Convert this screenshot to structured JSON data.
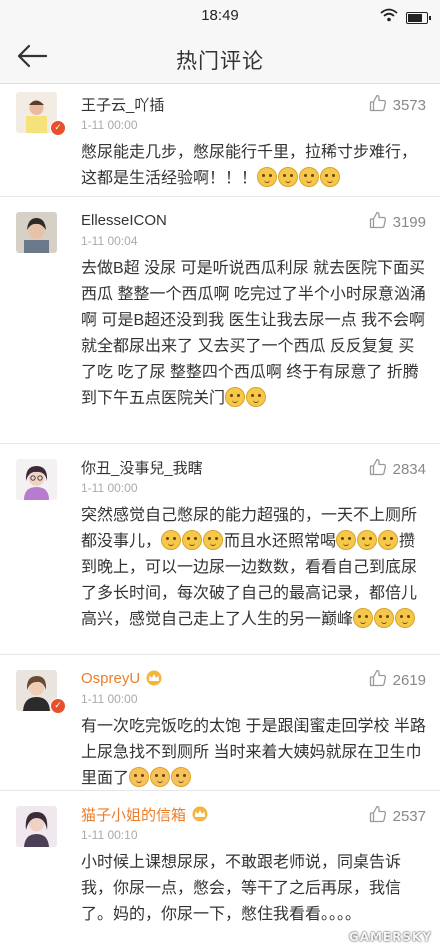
{
  "status_bar": {
    "time": "18:49"
  },
  "nav": {
    "title": "热门评论"
  },
  "comments": [
    {
      "username": "王子云_吖插",
      "time": "1-11 00:00",
      "likes": "3573",
      "segments": [
        {
          "t": "text",
          "v": "憋尿能走几步，憋尿能行千里，拉稀寸步难行，这都是生活经验啊！！！"
        },
        {
          "t": "emoji",
          "n": 4,
          "kind": "cat"
        }
      ]
    },
    {
      "username": "EllesseICON",
      "time": "1-11 00:04",
      "likes": "3199",
      "segments": [
        {
          "t": "text",
          "v": "去做B超 没尿 可是听说西瓜利尿 就去医院下面买西瓜 整整一个西瓜啊 吃完过了半个小时尿意汹涌啊 可是B超还没到我 医生让我去尿一点 我不会啊 就全都尿出来了 又去买了一个西瓜 反反复复 买了吃 吃了尿 整整四个西瓜啊 终于有尿意了 折腾到下午五点医院关门"
        },
        {
          "t": "emoji",
          "n": 2,
          "kind": "cat"
        }
      ]
    },
    {
      "username": "你丑_没事兒_我瞎",
      "time": "1-11 00:00",
      "likes": "2834",
      "segments": [
        {
          "t": "text",
          "v": "突然感觉自己憋尿的能力超强的，一天不上厕所都没事儿，"
        },
        {
          "t": "emoji",
          "n": 3,
          "kind": "cat"
        },
        {
          "t": "text",
          "v": "而且水还照常喝"
        },
        {
          "t": "emoji",
          "n": 3,
          "kind": "cat"
        },
        {
          "t": "text",
          "v": "攒到晚上，可以一边尿一边数数，看看自己到底尿了多长时间，每次破了自己的最高记录，都倍儿高兴，感觉自己走上了人生的另一巅峰"
        },
        {
          "t": "emoji",
          "n": 3,
          "kind": "cat"
        }
      ]
    },
    {
      "username": "OspreyU",
      "time": "1-11 00:00",
      "likes": "2619",
      "segments": [
        {
          "t": "text",
          "v": "有一次吃完饭吃的太饱 于是跟闺蜜走回学校 半路上尿急找不到厕所 当时来着大姨妈就尿在卫生巾里面了"
        },
        {
          "t": "emoji",
          "n": 3,
          "kind": "clap"
        }
      ]
    },
    {
      "username": "猫子小姐的信箱",
      "time": "1-11 00:10",
      "likes": "2537",
      "segments": [
        {
          "t": "text",
          "v": "小时候上课想尿尿，不敢跟老师说，同桌告诉我，你尿一点，憋会，等干了之后再尿，我信了。妈的，你尿一下，憋住我看看。。。。"
        }
      ]
    }
  ],
  "watermark": "GAMERSKY",
  "icons": {
    "back": "back-arrow-icon",
    "like": "thumbs-up-icon",
    "wifi": "wifi-icon",
    "battery": "battery-icon",
    "crown": "crown-icon",
    "badge": "verified-badge-icon"
  },
  "battery_level": 0.85,
  "colors": {
    "vip_name": "#ec7d2b",
    "badge": "#e8502c",
    "bar": "#f7f7f7"
  }
}
